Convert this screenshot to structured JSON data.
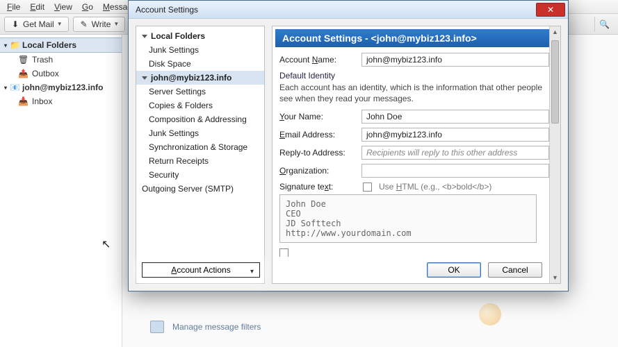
{
  "menubar": {
    "file": "File",
    "edit": "Edit",
    "view": "View",
    "go": "Go",
    "message": "Message"
  },
  "toolbar": {
    "get_mail": "Get Mail",
    "write": "Write"
  },
  "folder_tree": {
    "local_folders": "Local Folders",
    "trash": "Trash",
    "outbox": "Outbox",
    "account": "john@mybiz123.info",
    "inbox": "Inbox"
  },
  "content": {
    "manage_filters": "Manage message filters"
  },
  "dialog": {
    "title": "Account Settings",
    "close": "✕",
    "nav": {
      "local_folders": "Local Folders",
      "junk": "Junk Settings",
      "disk": "Disk Space",
      "account": "john@mybiz123.info",
      "server": "Server Settings",
      "copies": "Copies & Folders",
      "comp": "Composition & Addressing",
      "junk2": "Junk Settings",
      "sync": "Synchronization & Storage",
      "receipts": "Return Receipts",
      "security": "Security",
      "smtp": "Outgoing Server (SMTP)",
      "actions": "Account Actions"
    },
    "panel": {
      "header": "Account Settings - <john@mybiz123.info>",
      "account_name_label": "Account Name:",
      "account_name_value": "john@mybiz123.info",
      "identity_title": "Default Identity",
      "identity_desc": "Each account has an identity, which is the information that other people see when they read your messages.",
      "your_name_label": "Your Name:",
      "your_name_value": "John Doe",
      "email_label": "Email Address:",
      "email_value": "john@mybiz123.info",
      "reply_label": "Reply-to Address:",
      "reply_placeholder": "Recipients will reply to this other address",
      "org_label": "Organization:",
      "org_value": "",
      "sig_label": "Signature text:",
      "sig_html_label": "Use HTML (e.g., <b>bold</b>)",
      "sig_text": "John Doe\nCEO\nJD Softtech\nhttp://www.yourdomain.com",
      "ok": "OK",
      "cancel": "Cancel"
    }
  }
}
